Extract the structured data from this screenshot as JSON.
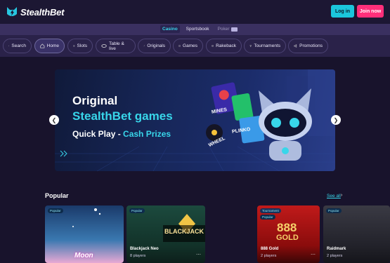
{
  "header": {
    "logo_text": "StealthBet",
    "login_label": "Log in",
    "join_label": "Join now"
  },
  "subnav": {
    "tabs": [
      {
        "label": "Casino",
        "active": true
      },
      {
        "label": "Sportsbook",
        "active": false
      },
      {
        "label": "Poker",
        "active": false
      }
    ]
  },
  "categories": [
    {
      "label": "Search",
      "icon": "search-icon"
    },
    {
      "label": "Home",
      "icon": "home-icon",
      "active": true
    },
    {
      "label": "Slots",
      "icon": "slots-icon"
    },
    {
      "label": "Table & live",
      "icon": "cards-icon"
    },
    {
      "label": "Originals",
      "icon": "rocket-icon"
    },
    {
      "label": "Games",
      "icon": "dice-icon"
    },
    {
      "label": "Rakeback",
      "icon": "coins-icon"
    },
    {
      "label": "Tournaments",
      "icon": "trophy-icon"
    },
    {
      "label": "Promotions",
      "icon": "megaphone-icon"
    }
  ],
  "banner": {
    "line1": "Original",
    "line2": "StealthBet games",
    "sub_part1": "Quick Play - ",
    "sub_part2": "Cash Prizes",
    "art_labels": [
      "MINES",
      "PLINKO",
      "WHEEL"
    ]
  },
  "popular": {
    "title": "Popular",
    "see_all": "See all",
    "cards": [
      {
        "tag": "Popular",
        "name": "",
        "players": "",
        "art_text": "Moon"
      },
      {
        "tag": "Popular",
        "name": "Blackjack Neo",
        "players": "8 players",
        "art_text": "BLACKJACK"
      },
      {
        "tag": "Tournament",
        "tag2": "Popular",
        "name": "888 Gold",
        "players": "2 players",
        "art_text": "888",
        "art_text2": "GOLD"
      },
      {
        "tag": "Popular",
        "name": "Raidmark",
        "players": "2 players"
      }
    ]
  },
  "colors": {
    "accent": "#38d6ea",
    "join": "#ff2f7a",
    "login": "#1bc6dc"
  }
}
